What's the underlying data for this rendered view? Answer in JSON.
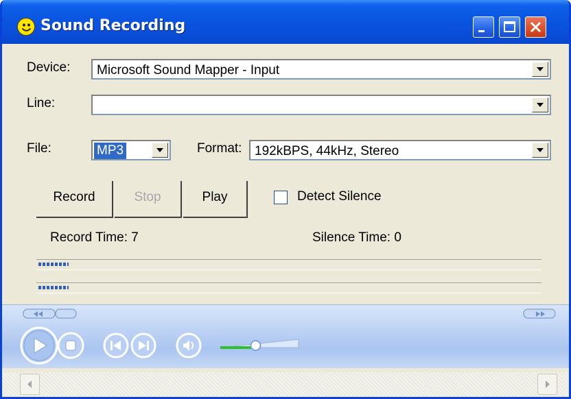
{
  "window": {
    "title": "Sound Recording",
    "buttons": [
      "minimize",
      "maximize",
      "close"
    ]
  },
  "form": {
    "device": {
      "label": "Device:",
      "value": "Microsoft Sound Mapper - Input"
    },
    "line": {
      "label": "Line:",
      "value": ""
    },
    "file": {
      "label": "File:",
      "value": "MP3"
    },
    "format": {
      "label": "Format:",
      "value": "192kBPS, 44kHz, Stereo"
    }
  },
  "controls": {
    "record_label": "Record",
    "stop_label": "Stop",
    "play_label": "Play",
    "detect_silence_label": "Detect Silence",
    "detect_silence_checked": false
  },
  "status": {
    "record_time": "Record Time: 7",
    "silence_time": "Silence Time: 0"
  },
  "meters": {
    "left_level": 0.06,
    "right_level": 0.06
  },
  "player": {
    "volume_level": 0.45,
    "icons": [
      "seek-back-icon",
      "seek-forward-icon",
      "play-icon",
      "stop-icon",
      "previous-icon",
      "next-icon",
      "mute-icon",
      "volume-slider"
    ]
  },
  "colors": {
    "title_bar": "#0a55e0",
    "window_face": "#ece9d8",
    "selection": "#316ac5",
    "meter_fill": "#2f5fb8",
    "volume_fill": "#2fbf2f"
  }
}
